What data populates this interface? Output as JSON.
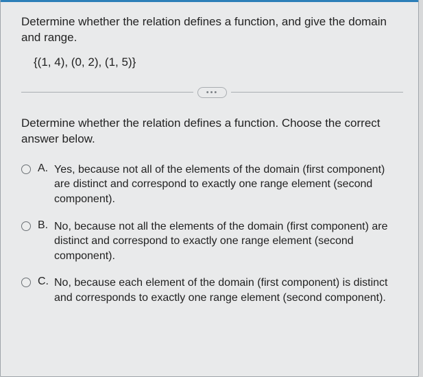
{
  "question": {
    "prompt": "Determine whether the relation defines a function, and give the domain and range.",
    "relation": "{(1, 4), (0, 2), (1, 5)}"
  },
  "divider_label": "•••",
  "subprompt": "Determine whether the relation defines a function. Choose the correct answer below.",
  "options": [
    {
      "letter": "A.",
      "text": "Yes, because not all of the elements of the domain (first component) are distinct and correspond to exactly one range element (second component)."
    },
    {
      "letter": "B.",
      "text": "No, because not all the elements of the domain (first component) are distinct and correspond to exactly one range element (second component)."
    },
    {
      "letter": "C.",
      "text": "No, because each element of the domain (first component) is distinct and corresponds to exactly one range element (second component)."
    }
  ]
}
